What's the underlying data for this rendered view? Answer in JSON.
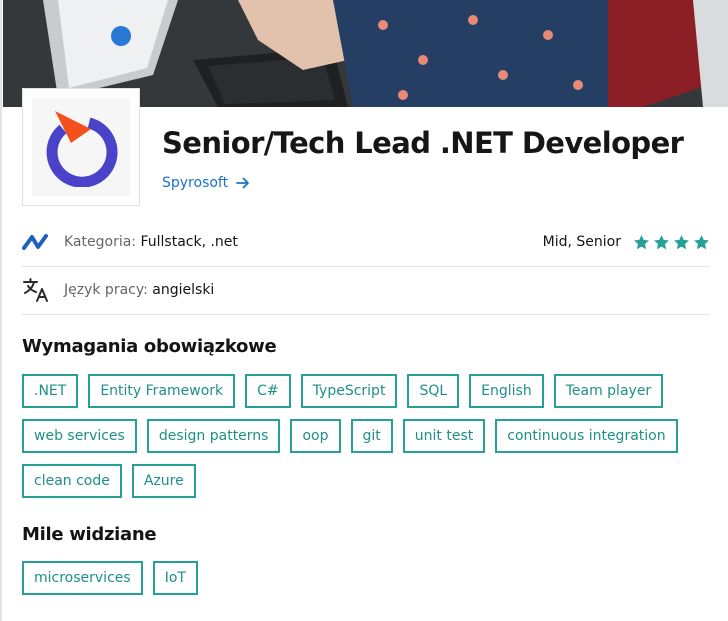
{
  "job": {
    "title": "Senior/Tech Lead .NET Developer",
    "company": "Spyrosoft"
  },
  "details": {
    "category_label": "Kategoria: ",
    "category_value": "Fullstack, .net",
    "level": "Mid, Senior",
    "stars": 4,
    "language_label": "Język pracy: ",
    "language_value": "angielski"
  },
  "required": {
    "title": "Wymagania obowiązkowe",
    "tags": [
      ".NET",
      "Entity Framework",
      "C#",
      "TypeScript",
      "SQL",
      "English",
      "Team player",
      "web services",
      "design patterns",
      "oop",
      "git",
      "unit test",
      "continuous integration",
      "clean code",
      "Azure"
    ]
  },
  "nice": {
    "title": "Mile widziane",
    "tags": [
      "microservices",
      "IoT"
    ]
  },
  "colors": {
    "accent": "#27a197",
    "link": "#1a73c9",
    "logo_orange": "#f2501c",
    "logo_purple": "#4a43c9"
  }
}
